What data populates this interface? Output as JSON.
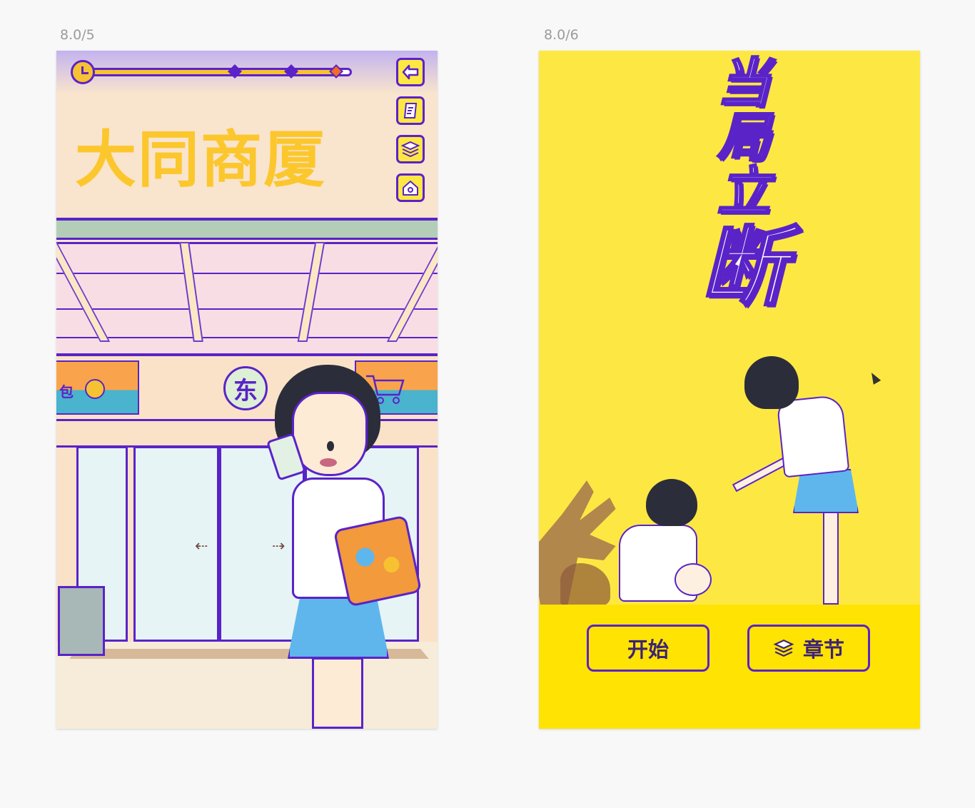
{
  "artboards": {
    "left_label": "8.0/5",
    "right_label": "8.0/6"
  },
  "screen5": {
    "store_sign": "大同商厦",
    "store_badge": "东",
    "banner_left_text": "包",
    "progress_percent": 96,
    "side_buttons": [
      "back-icon",
      "note-icon",
      "layers-icon",
      "home-icon"
    ],
    "colors": {
      "accent": "#5a23c8",
      "highlight": "#f7c232",
      "milestone_current": "#f36b25"
    }
  },
  "screen6": {
    "title_chars": [
      "当",
      "局",
      "立",
      "断"
    ],
    "start_label": "开始",
    "chapters_label": "章节",
    "colors": {
      "bg": "#fde843",
      "panel": "#ffe303",
      "outline": "#5a23c8"
    }
  }
}
